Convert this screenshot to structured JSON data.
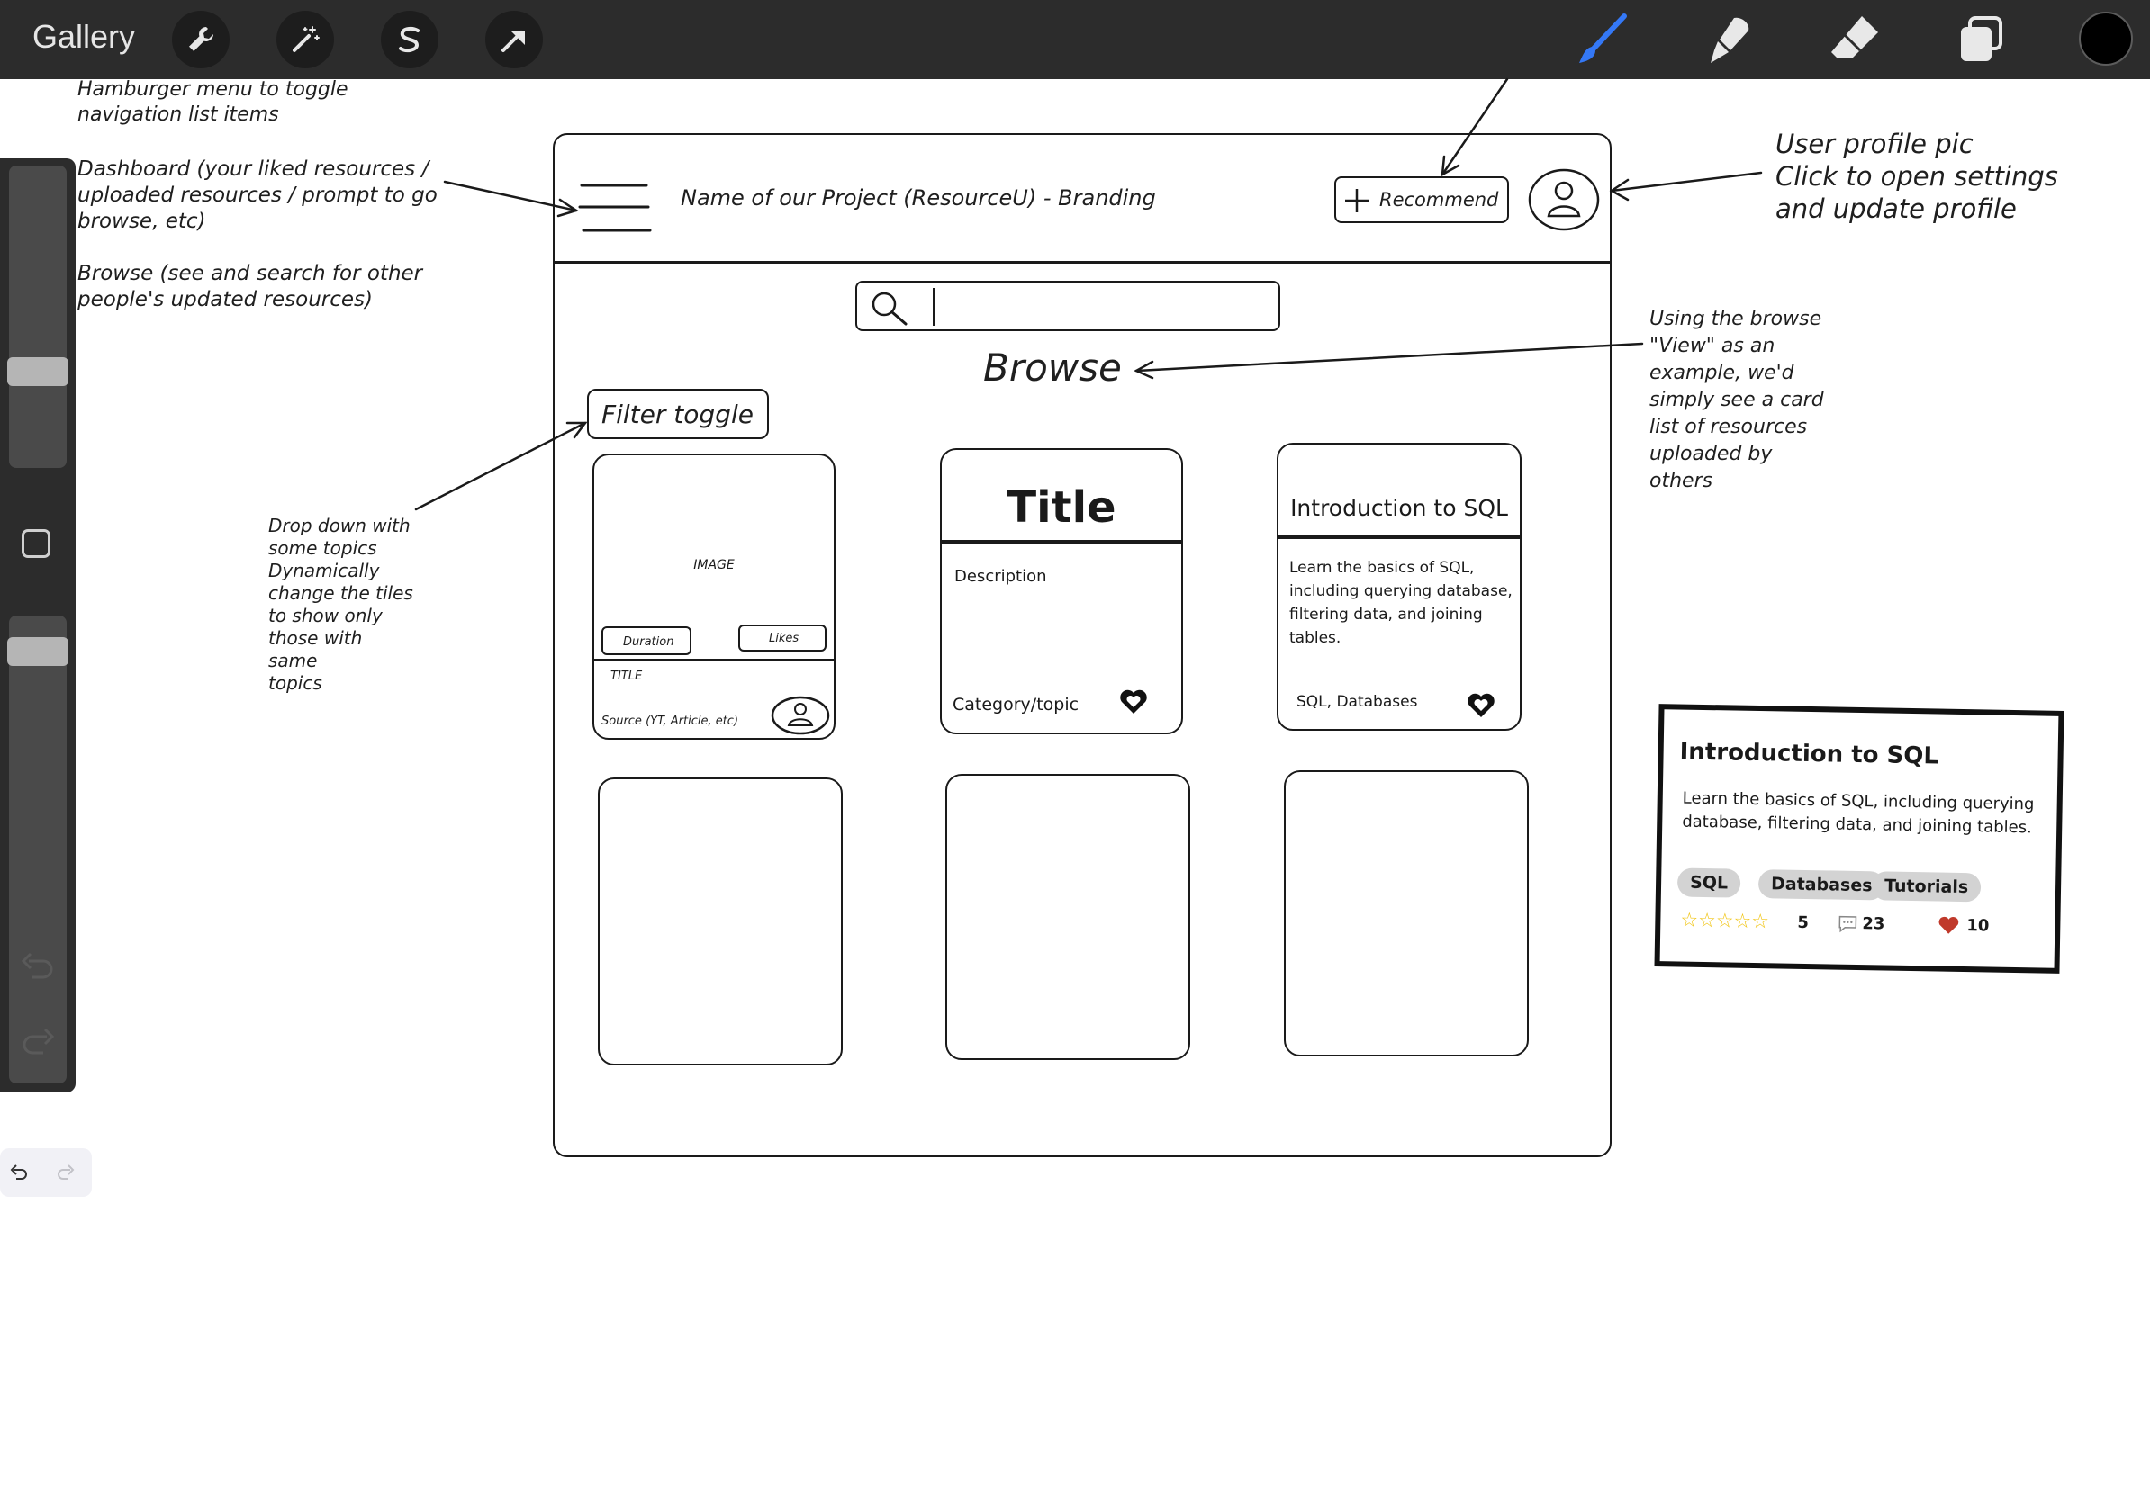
{
  "toolbar": {
    "gallery_label": "Gallery",
    "left_tools": [
      {
        "icon": "wrench-icon"
      },
      {
        "icon": "magic-wand-icon"
      },
      {
        "icon": "selection-s-icon"
      },
      {
        "icon": "arrow-cursor-icon"
      }
    ],
    "right_tools": [
      {
        "icon": "brush-icon",
        "active_color": "#3478f6"
      },
      {
        "icon": "smudge-icon"
      },
      {
        "icon": "eraser-icon"
      },
      {
        "icon": "layers-icon"
      }
    ],
    "current_color": "#000000"
  },
  "sidebar": {
    "brush_size_level": 0.3,
    "opacity_level": 0.95
  },
  "annotations": {
    "hamburger": "Hamburger menu to toggle\nnavigation list items",
    "dashboard": "Dashboard (your liked resources /\nuploaded resources / prompt to go\nbrowse, etc)",
    "browse": "Browse (see and search for other\npeople's updated resources)",
    "profile": "User profile pic\nClick to open settings\nand update profile",
    "view": "Using the browse\n\"View\" as an\nexample, we'd\nsimply see a card\nlist of resources\nuploaded by\nothers",
    "dropdown": "Drop down with\nsome topics\nDynamically\nchange the tiles\nto show only\nthose with\nsame\ntopics"
  },
  "wireframe": {
    "branding": "Name of our Project (ResourceU) - Branding",
    "recommend_label": "Recommend",
    "browse_title": "Browse",
    "filter_label": "Filter toggle",
    "card1": {
      "image": "IMAGE",
      "duration": "Duration",
      "likes": "Likes",
      "title": "TITLE",
      "source": "Source (YT, Article, etc)"
    },
    "card2": {
      "title": "Title",
      "description": "Description",
      "category": "Category/topic"
    },
    "card3": {
      "title": "Introduction to SQL",
      "description": "Learn the basics of SQL,\nincluding querying database,\nfiltering data, and joining\ntables.",
      "tags": "SQL, Databases"
    }
  },
  "detail_card": {
    "title": "Introduction to SQL",
    "description": "Learn the basics of SQL, including querying\ndatabase, filtering data, and joining tables.",
    "tags": [
      "SQL",
      "Databases",
      "Tutorials"
    ],
    "stars": "☆☆☆☆☆",
    "rating": "5",
    "comments": "23",
    "likes": "10"
  }
}
